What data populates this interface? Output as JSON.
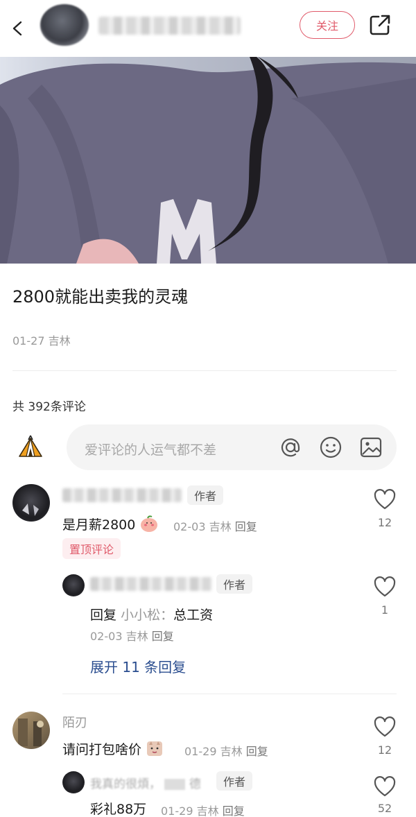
{
  "header": {
    "follow_label": "关注"
  },
  "post": {
    "title": "2800就能出卖我的灵魂",
    "meta": "01-27 吉林"
  },
  "comments_header": {
    "count_text": "共 392条评论"
  },
  "comment_input": {
    "placeholder": "爱评论的人运气都不差"
  },
  "comments": [
    {
      "author_tag": "作者",
      "text": "是月薪2800",
      "date": "02-03",
      "location": "吉林",
      "reply_label": "回复",
      "likes": "12",
      "pinned_label": "置顶评论",
      "replies": [
        {
          "author_tag": "作者",
          "reply_prefix": "回复",
          "reply_to": "小小松：",
          "text": "总工资",
          "date": "02-03",
          "location": "吉林",
          "reply_label": "回复",
          "likes": "1"
        }
      ],
      "expand_label": "展开 11 条回复"
    },
    {
      "author": "陌刃",
      "text": "请问打包啥价",
      "date": "01-29",
      "location": "吉林",
      "reply_label": "回复",
      "likes": "12",
      "replies": [
        {
          "author_partial": "我真的很煩，",
          "author_partial_end": "德",
          "author_tag": "作者",
          "text": "彩礼88万",
          "date": "01-29",
          "location": "吉林",
          "reply_label": "回复",
          "likes": "52"
        }
      ]
    }
  ],
  "colors": {
    "accent": "#e05a6a",
    "link": "#2a4d8f",
    "meta": "#999999"
  }
}
